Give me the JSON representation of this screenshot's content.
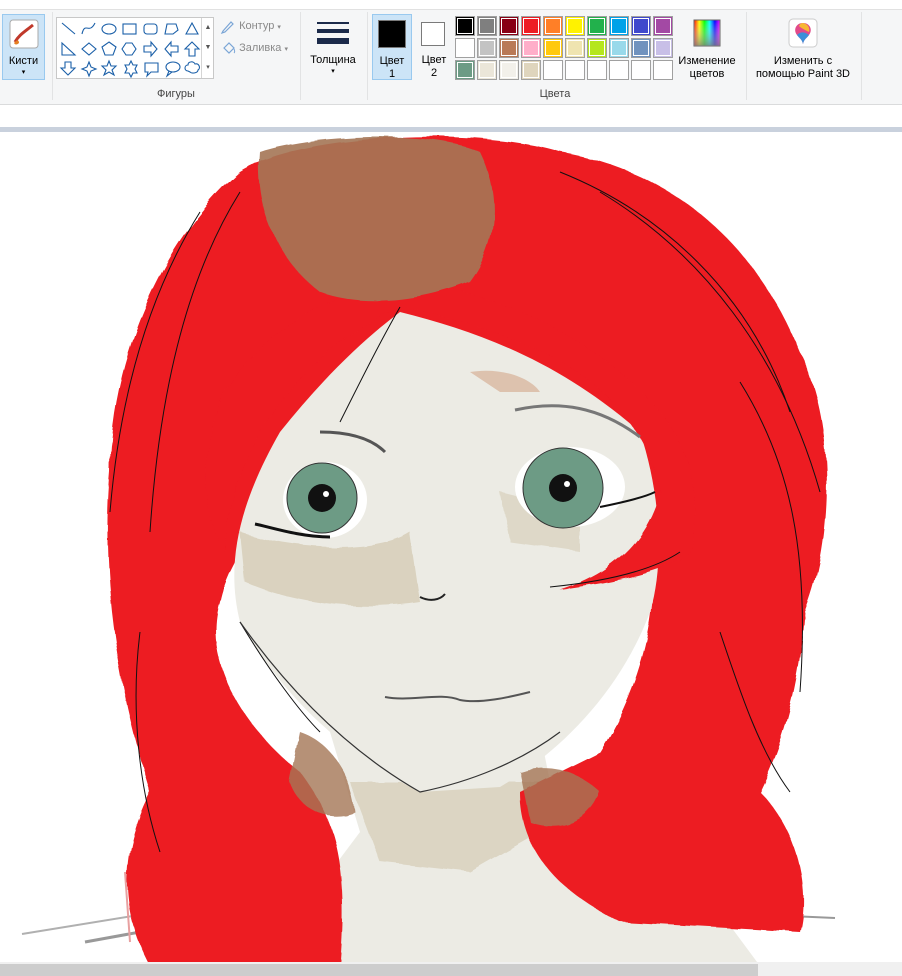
{
  "ribbon": {
    "brushes": {
      "label": "Кисти",
      "dropdown": "▾"
    },
    "shapes_group_label": "Фигуры",
    "outline_label": "Контур",
    "fill_label": "Заливка",
    "thickness_label": "Толщина",
    "color1": {
      "label_line1": "Цвет",
      "label_line2": "1",
      "value": "#000000"
    },
    "color2": {
      "label_line1": "Цвет",
      "label_line2": "2",
      "value": "#ffffff"
    },
    "colors_group_label": "Цвета",
    "edit_colors": {
      "line1": "Изменение",
      "line2": "цветов"
    },
    "paint3d": {
      "line1": "Изменить с",
      "line2": "помощью Paint 3D"
    },
    "palette": [
      "#000000",
      "#7f7f7f",
      "#880015",
      "#ed1c24",
      "#ff7f27",
      "#fff200",
      "#22b14c",
      "#00a2e8",
      "#3f48cc",
      "#a349a4",
      "#ffffff",
      "#c3c3c3",
      "#b97a57",
      "#ffaec9",
      "#ffc90e",
      "#efe4b0",
      "#b5e61d",
      "#99d9ea",
      "#7092be",
      "#c8bfe7",
      "#6d9b85",
      "#ebe6d9",
      "#f2f0ea",
      "#dfd5bd",
      "#ffffff",
      "#ffffff",
      "#ffffff",
      "#ffffff",
      "#ffffff",
      "#ffffff"
    ]
  },
  "shapes": [
    "line",
    "curve",
    "oval",
    "rectangle",
    "rounded-rectangle",
    "polygon",
    "triangle",
    "right-triangle",
    "diamond",
    "pentagon",
    "hexagon",
    "right-arrow",
    "left-arrow",
    "up-arrow",
    "down-arrow",
    "four-point-star",
    "five-point-star",
    "six-point-star",
    "rounded-callout",
    "oval-callout",
    "cloud-callout"
  ],
  "drawing_colors": {
    "hair": "#ed1c24",
    "hair_brown": "#a57656",
    "skin": "#ecebe4",
    "iris": "#6d9b85",
    "shading": "#d6cdb6"
  }
}
